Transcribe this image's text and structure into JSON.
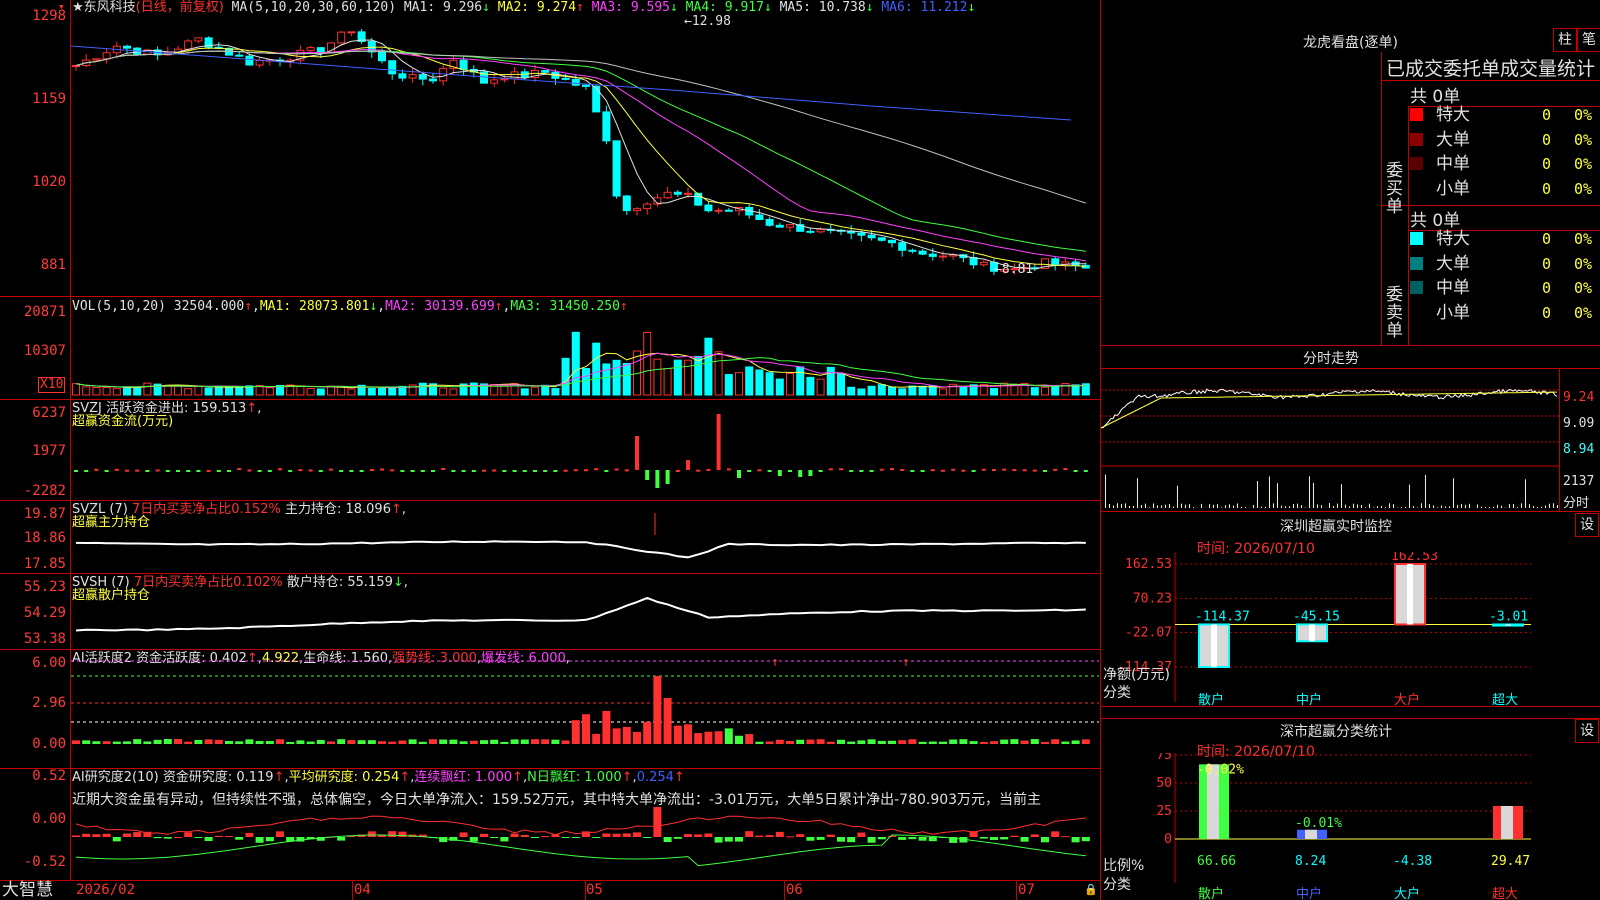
{
  "app": {
    "brand": "大智慧",
    "icon_name": "lock-icon"
  },
  "kline": {
    "star": "★",
    "stock": "东风科技",
    "mode": "(日线，前复权)",
    "ma_label": "MA(5,10,20,30,60,120)",
    "ma": [
      {
        "name": "MA1",
        "value": "9.296",
        "arrow": "↓",
        "color": "#e0e0e0"
      },
      {
        "name": "MA2",
        "value": "9.274",
        "arrow": "↑",
        "color": "#ffff40"
      },
      {
        "name": "MA3",
        "value": "9.595",
        "arrow": "↓",
        "color": "#ff40ff"
      },
      {
        "name": "MA4",
        "value": "9.917",
        "arrow": "↓",
        "color": "#40ff40"
      },
      {
        "name": "MA5",
        "value": "10.738",
        "arrow": "↓",
        "color": "#e0e0e0"
      },
      {
        "name": "MA6",
        "value": "11.212",
        "arrow": "↓",
        "color": "#4060ff"
      }
    ],
    "y_labels": [
      "1298",
      "1159",
      "1020",
      "881"
    ],
    "high_label": "12.98",
    "low_label": "8.81"
  },
  "vol": {
    "header": "VOL(5,10,20)",
    "value": "32504.000",
    "value_arrow": "↑",
    "ma1": "MA1: 28073.801",
    "ma1_arrow": "↓",
    "ma2": "MA2: 30139.699",
    "ma2_arrow": "↑",
    "ma3": "MA3: 31450.250",
    "ma3_arrow": "↑",
    "y_labels": [
      "20871",
      "10307"
    ],
    "unit": "X10"
  },
  "svzj": {
    "header": "SVZJ  活跃资金进出: 159.513",
    "arrow": "↑",
    "subtitle": "超赢资金流(万元)",
    "y_labels": [
      "6237",
      "1977",
      "-2282"
    ]
  },
  "svzl": {
    "name": "SVZL (7)",
    "ratio": "7日内买卖净占比0.152%",
    "holding": "主力持仓: 18.096",
    "arrow": "↑",
    "subtitle": "超赢主力持仓",
    "y_labels": [
      "19.87",
      "18.86",
      "17.85"
    ]
  },
  "svsh": {
    "name": "SVSH (7)",
    "ratio": "7日内买卖净占比0.102%",
    "holding": "散户持仓: 55.159",
    "arrow": "↓",
    "subtitle": "超赢散户持仓",
    "y_labels": [
      "55.23",
      "54.29",
      "53.38"
    ]
  },
  "ai_active": {
    "name": "AI活跃度2",
    "active": "资金活跃度: 0.402",
    "active_arrow": "↑",
    "v2": "4.922",
    "life": "生命线: 1.560",
    "strong": "强势线: 3.000",
    "burst": "爆发线: 6.000",
    "y_labels": [
      "6.00",
      "2.96",
      "0.00"
    ]
  },
  "ai_research": {
    "name": "AI研究度2(10)",
    "research": "资金研究度: 0.119",
    "avg": "平均研究度: 0.254",
    "streak": "连续飘红: 1.000",
    "nday": "N日飘红: 1.000",
    "last": "0.254",
    "comment": "近期大资金虽有异动，但持续性不强，总体偏空，今日大单净流入：159.52万元，其中特大单净流出：-3.01万元，大单5日累计净出-780.903万元，当前主",
    "y_labels": [
      "0.52",
      "0.00",
      "-0.52"
    ]
  },
  "x_axis": [
    "2026/02",
    "04",
    "05",
    "06",
    "07"
  ],
  "dragon": {
    "title": "龙虎看盘(逐单)",
    "btn1": "柱",
    "btn2": "笔",
    "subtitle": "已成交委托单成交量统计",
    "buy": {
      "side": "委买单",
      "total": "共 0单",
      "rows": [
        {
          "label": "特大",
          "value": "0",
          "pct": "0%",
          "color": "#ff0000"
        },
        {
          "label": "大单",
          "value": "0",
          "pct": "0%",
          "color": "#8b0000"
        },
        {
          "label": "中单",
          "value": "0",
          "pct": "0%",
          "color": "#5a0000"
        },
        {
          "label": "小单",
          "value": "0",
          "pct": "0%",
          "color": ""
        }
      ]
    },
    "sell": {
      "side": "委卖单",
      "total": "共 0单",
      "rows": [
        {
          "label": "特大",
          "value": "0",
          "pct": "0%",
          "color": "#00ffff"
        },
        {
          "label": "大单",
          "value": "0",
          "pct": "0%",
          "color": "#008080"
        },
        {
          "label": "中单",
          "value": "0",
          "pct": "0%",
          "color": "#006060"
        },
        {
          "label": "小单",
          "value": "0",
          "pct": "0%",
          "color": ""
        }
      ]
    }
  },
  "intraday": {
    "title": "分时走势",
    "prices": [
      "9.24",
      "9.09",
      "8.94"
    ],
    "vol": "2137",
    "vol_unit": "分时"
  },
  "sz_monitor": {
    "title": "深圳超赢实时监控",
    "settings": "设",
    "time": "时间: 2026/07/10",
    "y_labels": [
      "162.53",
      "70.23",
      "-22.07",
      "-114.37"
    ],
    "y_axis_title": "净额(万元)",
    "x_axis_title": "分类",
    "bars": [
      {
        "label": "散户",
        "value": "-114.37",
        "color": "#00ffff"
      },
      {
        "label": "中户",
        "value": "-45.15",
        "color": "#00ffff"
      },
      {
        "label": "大户",
        "value": "162.53",
        "color": "#ff3030"
      },
      {
        "label": "超大",
        "value": "-3.01",
        "color": "#00ffff"
      }
    ]
  },
  "sz_class": {
    "title": "深市超赢分类统计",
    "settings": "设",
    "time": "时间: 2026/07/10",
    "y_labels": [
      "75",
      "50",
      "25",
      "0"
    ],
    "y_axis_title": "比例%",
    "x_axis_title": "分类",
    "bars": [
      {
        "label": "散户",
        "value": "66.66",
        "change": "-0.02%",
        "fill": "#40ff40"
      },
      {
        "label": "中户",
        "value": "8.24",
        "change": "-0.01%",
        "fill": "#4060ff"
      },
      {
        "label": "大户",
        "value": "-4.38",
        "change": "",
        "fill": "#40ff40"
      },
      {
        "label": "超大",
        "value": "29.47",
        "change": "",
        "fill": "#ff3030"
      }
    ]
  },
  "chart_data": {
    "type": "bar",
    "title": "深圳超赢实时监控",
    "ylabel": "净额(万元)",
    "xlabel": "分类",
    "categories": [
      "散户",
      "中户",
      "大户",
      "超大"
    ],
    "values": [
      -114.37,
      -45.15,
      162.53,
      -3.01
    ],
    "ylim": [
      -114.37,
      162.53
    ]
  }
}
